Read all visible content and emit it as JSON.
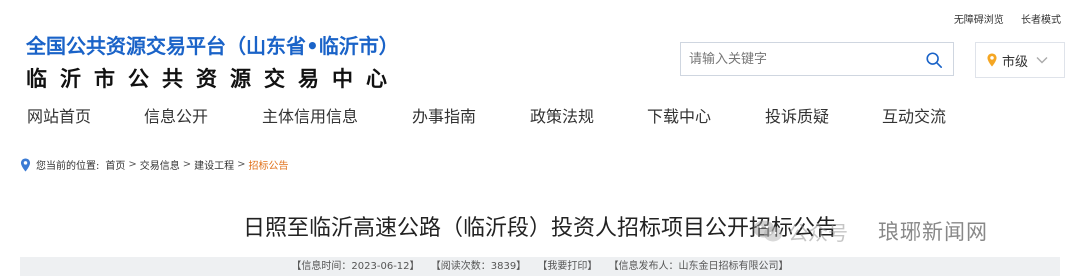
{
  "top_links": {
    "accessibility": "无障碍浏览",
    "elder_mode": "长者模式"
  },
  "logo": {
    "title": "全国公共资源交易平台（山东省•临沂市）",
    "subtitle": "临沂市公共资源交易中心"
  },
  "search": {
    "placeholder": "请输入关键字",
    "value": ""
  },
  "region": {
    "label": "市级"
  },
  "nav": [
    "网站首页",
    "信息公开",
    "主体信用信息",
    "办事指南",
    "政策法规",
    "下载中心",
    "投诉质疑",
    "互动交流"
  ],
  "breadcrumb": {
    "prefix": "您当前的位置:",
    "items": [
      "首页",
      "交易信息",
      "建设工程"
    ],
    "current": "招标公告",
    "separator": ">"
  },
  "article": {
    "title": "日照至临沂高速公路（临沂段）投资人招标项目公开招标公告"
  },
  "meta": {
    "date": "【信息时间：2023-06-12】",
    "views": "【阅读次数：3839】",
    "print": "【我要打印】",
    "publisher": "【信息发布人：山东金日招标有限公司】"
  },
  "watermark": {
    "gzh": "公众号",
    "name": "琅琊新闻网"
  },
  "colors": {
    "brand_blue": "#1a63c8",
    "crumb_current": "#e0701a",
    "region_pin": "#f5a623"
  }
}
